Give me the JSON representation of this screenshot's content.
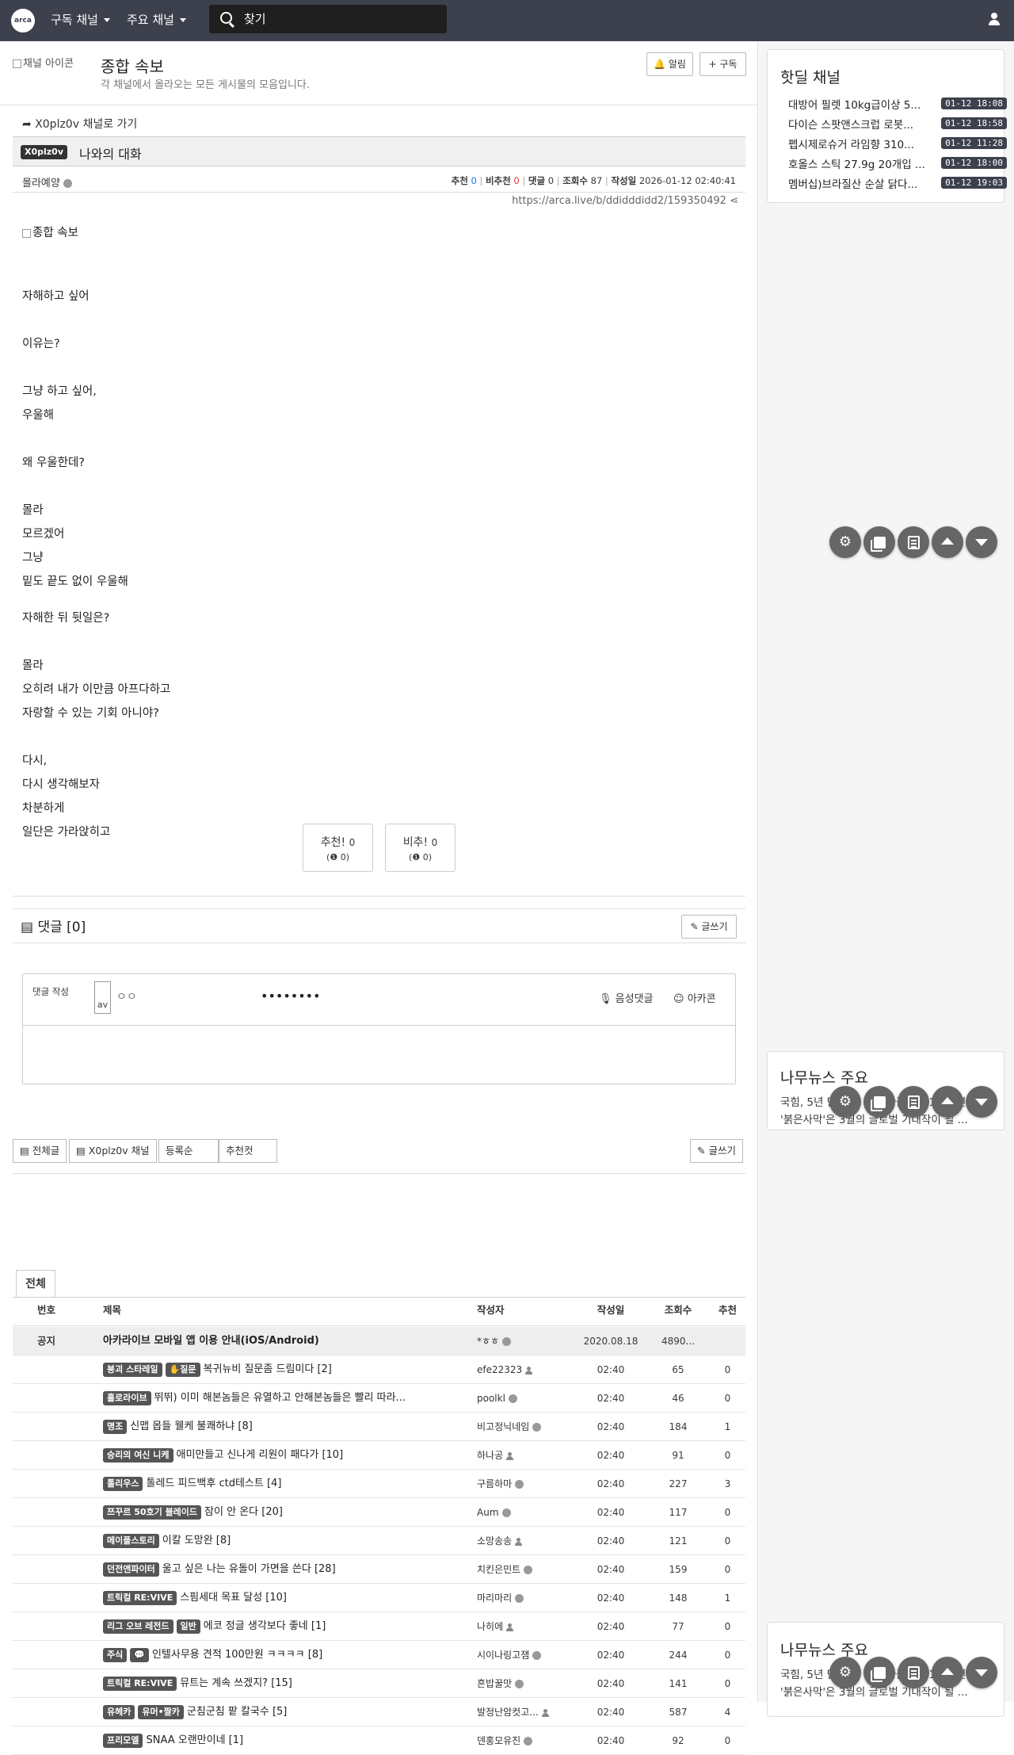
{
  "topbar": {
    "logo": "arca",
    "nav_subscribed": "구독 채널",
    "nav_major": "주요 채널",
    "search_placeholder": "찾기"
  },
  "board": {
    "icon_alt": "채널 아이콘",
    "title": "종합 속보",
    "description": "각 채널에서 올라오는 모든 게시물의 모음입니다.",
    "alarm_label": "알림",
    "subscribe_label": "구독"
  },
  "article": {
    "goto_channel": "X0plz0v 채널로 가기",
    "channel_badge": "X0plz0v",
    "title": "나와의 대화",
    "author": "몰라예양",
    "rec_label": "추천",
    "rec": "0",
    "unrec_label": "비추천",
    "unrec": "0",
    "comments_label": "댓글",
    "comments": "0",
    "views_label": "조회수",
    "views": "87",
    "date_label": "작성일",
    "date": "2026-01-12 02:40:41",
    "url": "https://arca.live/b/ddidddidd2/159350492",
    "image_alt": "종합 속보",
    "lines": [
      "자해하고 싶어",
      "이유는?",
      "그냥 하고 싶어,",
      "우울해",
      "왜 우울한데?",
      "몰라",
      "모르겠어",
      "그냥",
      "밑도 끝도 없이 우울해",
      "자해한 뒤 뒷일은?",
      "몰라",
      "오히려 내가 이만큼 아프다하고",
      "자랑할 수 있는 기회 아니야?",
      "다시,",
      "다시 생각해보자",
      "차분하게",
      "일단은 가라앉히고"
    ],
    "vote_up": "추천!",
    "vote_up_count": "0",
    "vote_up_sub": "0",
    "vote_down": "비추!",
    "vote_down_count": "0",
    "vote_down_sub": "0"
  },
  "comments": {
    "header": "댓글 [0]",
    "write_btn": "글쓰기",
    "write_label": "댓글 작성",
    "avatar_alt": "av",
    "name_placeholder": "ㅇㅇ",
    "password_dots": "••••••••",
    "voice_label": "음성댓글",
    "arcacon_label": "아카콘"
  },
  "toolbar": {
    "all_posts": "전체글",
    "channel": "X0plz0v 채널",
    "sort_label": "등록순",
    "best_label": "추천컷",
    "write": "글쓰기"
  },
  "list": {
    "tab_all": "전체",
    "columns": [
      "번호",
      "제목",
      "작성자",
      "작성일",
      "조회수",
      "추천"
    ],
    "notice": {
      "num": "공지",
      "title": "아카라이브 모바일 앱 이용 안내(iOS/Android)",
      "author": "*ㅎㅎ",
      "date": "2020.08.18",
      "views": "4890...",
      "rec": ""
    },
    "rows": [
      {
        "badges": [
          "붕괴 스타레일",
          "✋질문"
        ],
        "title": "복귀뉴비 질문좀 드림미다 [2]",
        "author": "efe22323",
        "date": "02:40",
        "views": "65",
        "rec": "0"
      },
      {
        "badges": [
          "홀로라이브"
        ],
        "title": "뛰뛰) 이미 해본놈들은 유열하고 안해본놈들은 빨리 따라...",
        "author": "poolkl",
        "date": "02:40",
        "views": "46",
        "rec": "0"
      },
      {
        "badges": [
          "명조"
        ],
        "title": "신맵 몹들 웰케 불쾌하냐 [8]",
        "author": "비고정닉네임",
        "date": "02:40",
        "views": "184",
        "rec": "1"
      },
      {
        "badges": [
          "승리의 여신 니케"
        ],
        "title": "애미만들고 신나게 리원이 패다가 [10]",
        "author": "하나공",
        "date": "02:40",
        "views": "91",
        "rec": "0"
      },
      {
        "badges": [
          "톨리우스"
        ],
        "title": "톨레드 피드백후 ctd테스트 [4]",
        "author": "구름하마",
        "date": "02:40",
        "views": "227",
        "rec": "3"
      },
      {
        "badges": [
          "쯔꾸르 50호기 블레이드"
        ],
        "title": "잠이 안 온다 [20]",
        "author": "Aum",
        "date": "02:40",
        "views": "117",
        "rec": "0"
      },
      {
        "badges": [
          "메이플스토리"
        ],
        "title": "이칼 도망완 [8]",
        "author": "소망송송",
        "date": "02:40",
        "views": "121",
        "rec": "0"
      },
      {
        "badges": [
          "던전앤파이터"
        ],
        "title": "울고 싶은 나는 유돌이 가면을 쓴다 [28]",
        "author": "치킨은민트",
        "date": "02:40",
        "views": "159",
        "rec": "0"
      },
      {
        "badges": [
          "트릭컬 RE:VIVE"
        ],
        "title": "스핌세대 목표 달성 [10]",
        "author": "마리마리",
        "date": "02:40",
        "views": "148",
        "rec": "1"
      },
      {
        "badges": [
          "리그 오브 레전드",
          "일반"
        ],
        "title": "에코 정글 생각보다 좋네 [1]",
        "author": "나히에",
        "date": "02:40",
        "views": "77",
        "rec": "0"
      },
      {
        "badges": [
          "주식",
          "💬"
        ],
        "title": "인텔사무용 견적 100만원 ㅋㅋㅋㅋ [8]",
        "author": "시이나링고잼",
        "date": "02:40",
        "views": "244",
        "rec": "0"
      },
      {
        "badges": [
          "트릭컬 RE:VIVE"
        ],
        "title": "뮤트는 계속 쓰겠지? [15]",
        "author": "흔밥꿀맛",
        "date": "02:40",
        "views": "141",
        "rec": "0"
      },
      {
        "badges": [
          "유헤카",
          "유머•짤카"
        ],
        "title": "군침군침 팥 칼국수 [5]",
        "author": "발정난암컷고...",
        "date": "02:40",
        "views": "587",
        "rec": "4"
      },
      {
        "badges": [
          "프리모엘"
        ],
        "title": "SNAA 오랜만이네 [1]",
        "author": "덴홍모유진",
        "date": "02:40",
        "views": "92",
        "rec": "0"
      }
    ]
  },
  "sidebar": {
    "hotdeal_title": "핫딜 채널",
    "hotdeals": [
      {
        "title": "대방어 필렛 10kg급이상 5...",
        "time": "01-12 18:08"
      },
      {
        "title": "다이슨 스팟앤스크럽 로봇...",
        "time": "01-12 18:58"
      },
      {
        "title": "펩시제로슈거 라임향 310...",
        "time": "01-12 11:28"
      },
      {
        "title": "호올스 스틱 27.9g 20개입 ...",
        "time": "01-12 18:00"
      },
      {
        "title": "멤버십)브라질산 순살 닭다...",
        "time": "01-12 19:03"
      }
    ],
    "news_title": "나무뉴스 주요",
    "news_line1": "국힘, 5년 만에 새 당명 바꾼다...'1997년...",
    "news_line2": "'붉은사막'은 3월의 글로벌 기대작이 될 ..."
  },
  "colors": {
    "topbar": "#3d414d",
    "rec": "#1a73e8",
    "unrec": "#e53935",
    "badge": "#555555"
  }
}
